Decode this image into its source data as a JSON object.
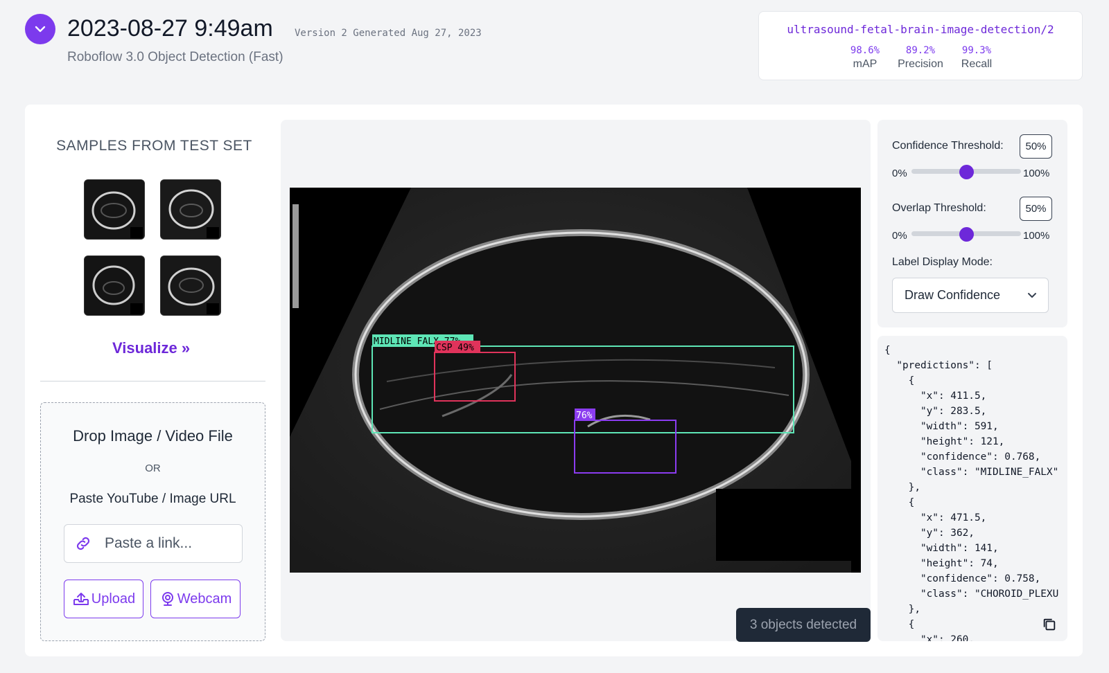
{
  "header": {
    "timestamp": "2023-08-27 9:49am",
    "version_line": "Version 2 Generated Aug 27, 2023",
    "model_type": "Roboflow 3.0 Object Detection (Fast)"
  },
  "model": {
    "name": "ultrasound-fetal-brain-image-detection/2",
    "metrics": [
      {
        "value": "98.6%",
        "label": "mAP"
      },
      {
        "value": "89.2%",
        "label": "Precision"
      },
      {
        "value": "99.3%",
        "label": "Recall"
      }
    ]
  },
  "samples": {
    "title": "SAMPLES FROM TEST SET",
    "visualize_label": "Visualize »"
  },
  "upload": {
    "drop_title": "Drop Image / Video File",
    "or_text": "OR",
    "paste_text": "Paste YouTube / Image URL",
    "link_placeholder": "Paste a link...",
    "upload_label": "Upload",
    "webcam_label": "Webcam"
  },
  "viewer": {
    "detections": [
      {
        "label": "MIDLINE FALX 77%",
        "color": "#5ee6b6"
      },
      {
        "label": "CSP 49%",
        "color": "#e0335b"
      },
      {
        "label": "76%",
        "color": "#8b3cf0"
      }
    ],
    "objects_detected": "3 objects detected"
  },
  "controls": {
    "confidence_label": "Confidence Threshold:",
    "confidence_value": "50%",
    "confidence_level": 0.5,
    "overlap_label": "Overlap Threshold:",
    "overlap_value": "50%",
    "overlap_level": 0.5,
    "range_min": "0%",
    "range_max": "100%",
    "label_mode_label": "Label Display Mode:",
    "label_mode_value": "Draw Confidence"
  },
  "json_output": "{\n  \"predictions\": [\n    {\n      \"x\": 411.5,\n      \"y\": 283.5,\n      \"width\": 591,\n      \"height\": 121,\n      \"confidence\": 0.768,\n      \"class\": \"MIDLINE_FALX\"\n    },\n    {\n      \"x\": 471.5,\n      \"y\": 362,\n      \"width\": 141,\n      \"height\": 74,\n      \"confidence\": 0.758,\n      \"class\": \"CHOROID_PLEXU\n    },\n    {\n      \"x\": 260,",
  "colors": {
    "accent": "#7c3aed",
    "accent_dark": "#6d28d9"
  }
}
